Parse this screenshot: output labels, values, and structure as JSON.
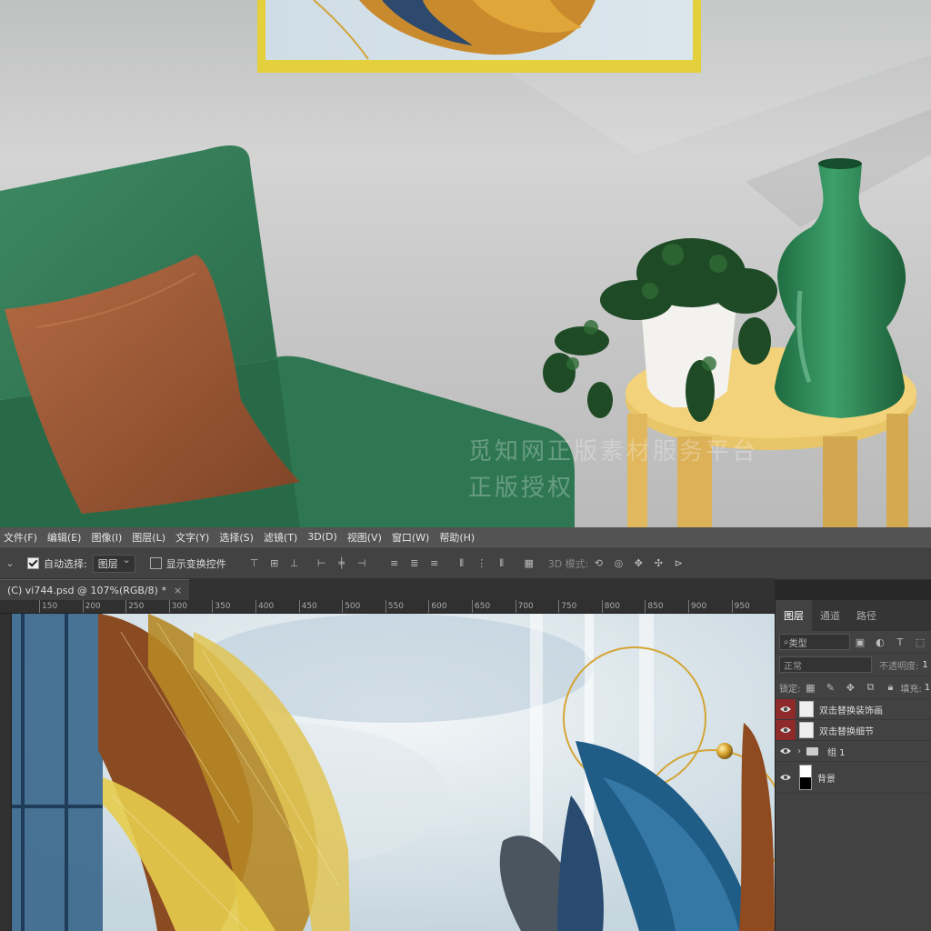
{
  "scene": {
    "watermark_line1": "觅知网正版素材服务平台",
    "watermark_line2": "正版授权"
  },
  "menu": [
    "文件(F)",
    "编辑(E)",
    "图像(I)",
    "图层(L)",
    "文字(Y)",
    "选择(S)",
    "滤镜(T)",
    "3D(D)",
    "视图(V)",
    "窗口(W)",
    "帮助(H)"
  ],
  "options": {
    "auto_select_label": "自动选择:",
    "auto_select_value": "图层",
    "show_transform_label": "显示变换控件",
    "mode_3d_label": "3D 模式:"
  },
  "document_tab": {
    "title": "(C) vi744.psd @ 107%(RGB/8) *",
    "close": "×"
  },
  "ruler_ticks": [
    "150",
    "200",
    "250",
    "300",
    "350",
    "400",
    "450",
    "500",
    "550",
    "600",
    "650",
    "700",
    "750",
    "800",
    "850",
    "900",
    "950"
  ],
  "layers_panel": {
    "tabs": [
      "图层",
      "通道",
      "路径"
    ],
    "filter_label": "类型",
    "blend_mode": "正常",
    "opacity_label": "不透明度:",
    "opacity_value": "1",
    "lock_label": "锁定:",
    "fill_label": "填充:",
    "fill_value": "1",
    "layers": [
      {
        "name": "双击替换装饰画",
        "eye_highlight": true,
        "type": "smart"
      },
      {
        "name": "双击替换细节",
        "eye_highlight": true,
        "type": "smart"
      },
      {
        "name": "组 1",
        "eye_highlight": false,
        "type": "group"
      },
      {
        "name": "背景",
        "eye_highlight": false,
        "type": "background"
      }
    ]
  }
}
